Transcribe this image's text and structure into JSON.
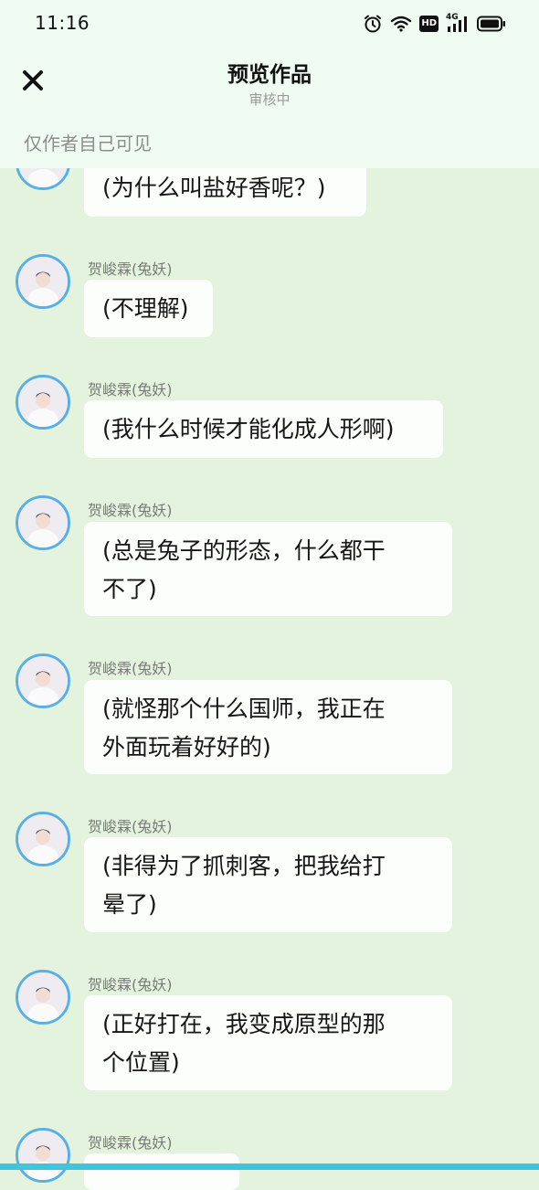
{
  "status_bar": {
    "time": "11:16",
    "icons": [
      "alarm-icon",
      "wifi-icon",
      "hd-icon",
      "4g-signal-icon",
      "battery-icon"
    ],
    "network_label": "4G",
    "hd_label": "HD"
  },
  "nav": {
    "close_icon": "close-icon",
    "title": "预览作品",
    "subtitle": "审核中"
  },
  "visibility_note": "仅作者自己可见",
  "colors": {
    "header_bg": "#f0fcf2",
    "page_bg": "#e4f3dd",
    "bubble_bg": "#fbfefa",
    "avatar_ring": "#5ab0e4",
    "bottom_strip": "#3ec6d8"
  },
  "messages": [
    {
      "sender": "",
      "lines": [
        "(为什么叫盐好香呢？)"
      ]
    },
    {
      "sender": "贺峻霖(兔妖)",
      "lines": [
        "(不理解)"
      ]
    },
    {
      "sender": "贺峻霖(兔妖)",
      "lines": [
        "(我什么时候才能化成人形啊)"
      ]
    },
    {
      "sender": "贺峻霖(兔妖)",
      "lines": [
        "(总是兔子的形态，什么都干",
        "不了)"
      ]
    },
    {
      "sender": "贺峻霖(兔妖)",
      "lines": [
        "(就怪那个什么国师，我正在",
        "外面玩着好好的)"
      ]
    },
    {
      "sender": "贺峻霖(兔妖)",
      "lines": [
        "(非得为了抓刺客，把我给打",
        "晕了)"
      ]
    },
    {
      "sender": "贺峻霖(兔妖)",
      "lines": [
        "(正好打在，我变成原型的那",
        "个位置)"
      ]
    },
    {
      "sender": "贺峻霖(兔妖)",
      "lines": [
        ""
      ]
    }
  ]
}
